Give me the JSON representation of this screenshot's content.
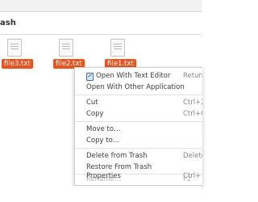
{
  "header": {
    "location_partial": "ash"
  },
  "files": [
    {
      "name": "file3.txt"
    },
    {
      "name": "file2.txt"
    },
    {
      "name": "file1.txt"
    }
  ],
  "context_menu": {
    "open_with_text_editor": {
      "label": "Open With Text Editor",
      "accel": "Return"
    },
    "open_with_other": {
      "label": "Open With Other Application"
    },
    "cut": {
      "label": "Cut",
      "accel": "Ctrl+X"
    },
    "copy": {
      "label": "Copy",
      "accel": "Ctrl+C"
    },
    "move_to": {
      "label": "Move to…"
    },
    "copy_to": {
      "label": "Copy to…"
    },
    "delete_from_trash": {
      "label": "Delete from Trash",
      "accel": "Delete"
    },
    "restore_from_trash": {
      "label": "Restore From Trash"
    },
    "rename": {
      "label": "Rename…",
      "accel": "F2"
    },
    "properties": {
      "label": "Properties",
      "accel": "Ctrl+I"
    }
  },
  "colors": {
    "selection": "#e95420"
  }
}
